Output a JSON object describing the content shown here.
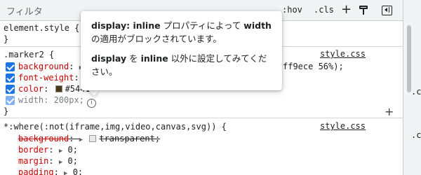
{
  "toolbar": {
    "filter_placeholder": "フィルタ",
    "hov_label": ":hov",
    "cls_label": ".cls",
    "new_rule_icon": "plus-icon",
    "paint_icon": "paint-bucket-icon",
    "sidebar_icon": "toggle-sidebar-icon"
  },
  "gutter": {
    "fragment": ".c"
  },
  "element_style": {
    "selector": "element.style {",
    "close": "}"
  },
  "rule_marker2": {
    "selector": ".marker2 {",
    "source": "style.css",
    "declarations": [
      {
        "name": "background",
        "value_tail": "ff9ece 56%);"
      },
      {
        "name": "font-weight",
        "value": ""
      },
      {
        "name": "color",
        "value": "#5441"
      },
      {
        "name": "width",
        "value": "200px;"
      }
    ],
    "color_swatch": "#4a3a1a",
    "add_icon": "plus-icon"
  },
  "rule_where": {
    "selector": "*:where(:not(iframe,img,video,canvas,svg)) {",
    "source": "style.css",
    "declarations": [
      {
        "name": "background",
        "value": "transparent;"
      },
      {
        "name": "border",
        "value": "0;"
      },
      {
        "name": "margin",
        "value": "0;"
      },
      {
        "name": "padding",
        "value": "0;"
      }
    ]
  },
  "tooltip": {
    "line1_a": "display: inline",
    "line1_b": " プロパティによって ",
    "line1_c": "width",
    "line1_d": " の適用がブロックされています。",
    "line2_a": "display",
    "line2_b": " を ",
    "line2_c": "inline",
    "line2_d": " 以外に設定してみてください。"
  },
  "colors": {
    "property_name": "#c80000",
    "checkbox": "#1a73e8",
    "toolbar_bg": "#f1f3f4"
  }
}
